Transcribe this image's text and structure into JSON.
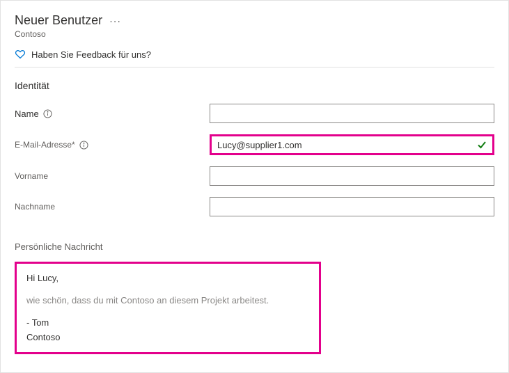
{
  "header": {
    "title": "Neuer Benutzer",
    "subtitle": "Contoso"
  },
  "feedback": {
    "text": "Haben Sie Feedback für uns?"
  },
  "section": {
    "identity_title": "Identität",
    "message_title": "Persönliche Nachricht"
  },
  "fields": {
    "name": {
      "label": "Name",
      "value": ""
    },
    "email": {
      "label": "E-Mail-Adresse*",
      "value": "Lucy@supplier1.com"
    },
    "firstname": {
      "label": "Vorname",
      "value": ""
    },
    "lastname": {
      "label": "Nachname",
      "value": ""
    }
  },
  "message": {
    "greeting": "Hi Lucy,",
    "body": "wie schön, dass du mit Contoso an diesem Projekt arbeitest.",
    "sig1": "- Tom",
    "sig2": "Contoso"
  }
}
